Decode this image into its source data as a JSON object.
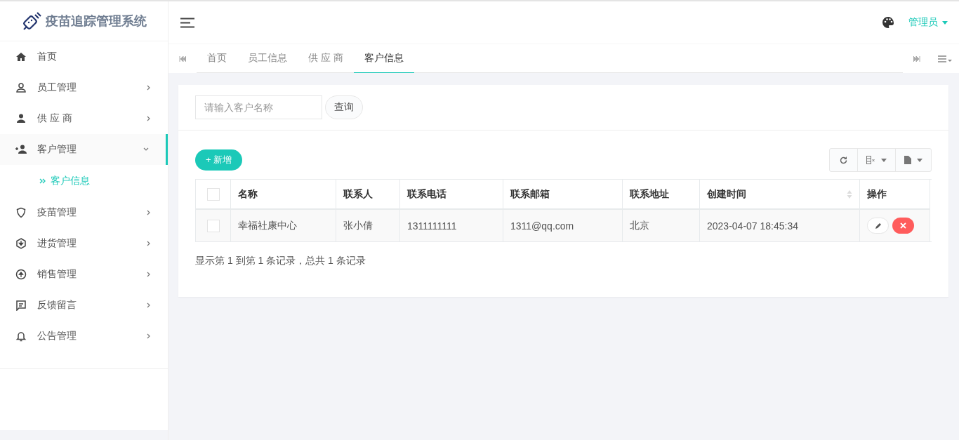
{
  "logo": {
    "title": "疫苗追踪管理系统"
  },
  "sidebar": {
    "items": [
      {
        "kind": "home",
        "label": "首页",
        "expanded": false
      },
      {
        "kind": "user-outline",
        "label": "员工管理",
        "expanded": false
      },
      {
        "kind": "user",
        "label": "供 应 商",
        "expanded": false
      },
      {
        "kind": "user-plus",
        "label": "客户管理",
        "expanded": true,
        "children": [
          {
            "label": "客户信息",
            "selected": true
          }
        ]
      },
      {
        "kind": "shield",
        "label": "疫苗管理",
        "expanded": false
      },
      {
        "kind": "hex-down",
        "label": "进货管理",
        "expanded": false
      },
      {
        "kind": "circle-up",
        "label": "销售管理",
        "expanded": false
      },
      {
        "kind": "message",
        "label": "反馈留言",
        "expanded": false
      },
      {
        "kind": "bell",
        "label": "公告管理",
        "expanded": false
      }
    ]
  },
  "header": {
    "user": "管理员"
  },
  "tabs": [
    {
      "label": "首页",
      "selected": false
    },
    {
      "label": "员工信息",
      "selected": false
    },
    {
      "label": "供 应 商",
      "selected": false
    },
    {
      "label": "客户信息",
      "selected": true
    }
  ],
  "search": {
    "placeholder": "请输入客户名称",
    "button": "查询"
  },
  "toolbar": {
    "add": "+ 新增"
  },
  "table": {
    "header_checked": false,
    "columns": [
      {
        "label": "名称",
        "sortable": false
      },
      {
        "label": "联系人",
        "sortable": false
      },
      {
        "label": "联系电话",
        "sortable": false
      },
      {
        "label": "联系邮箱",
        "sortable": false
      },
      {
        "label": "联系地址",
        "sortable": false
      },
      {
        "label": "创建时间",
        "sortable": true
      },
      {
        "label": "操作",
        "sortable": false
      }
    ],
    "rows": [
      {
        "checked": false,
        "cells": [
          "幸福社康中心",
          "张小倩",
          "1311111111",
          "1311@qq.com",
          "北京",
          "2023-04-07 18:45:34"
        ]
      }
    ]
  },
  "footer": "显示第 1 到第 1 条记录，总共 1 条记录"
}
